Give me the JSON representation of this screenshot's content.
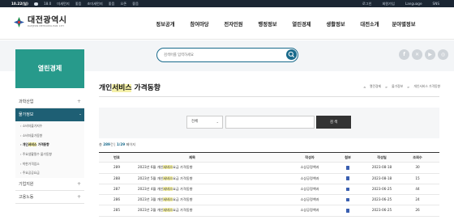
{
  "topbar": {
    "date": "10.22(일)",
    "temp": "18.0",
    "items": [
      "미세먼지",
      "좋음",
      "초미세먼지",
      "좋음",
      "오존",
      "좋음"
    ],
    "right": [
      "로그인",
      "회원가입",
      "Language",
      "SNS"
    ]
  },
  "header": {
    "logo_title": "대전광역시",
    "logo_sub": "DAEJEON METROPOLITAN CITY",
    "gnb": [
      "정보공개",
      "참여마당",
      "전자민원",
      "행정정보",
      "열린경제",
      "생활정보",
      "대전소개",
      "분야별정보"
    ]
  },
  "search": {
    "placeholder": "검색어를 입력하세요"
  },
  "sns": [
    "f",
    "✕",
    "▶",
    "◎"
  ],
  "lnb": {
    "title": "열린경제",
    "items": [
      {
        "label": "과학산업",
        "pm": "+"
      },
      {
        "label": "물가정보",
        "pm": "-"
      }
    ],
    "sub": [
      "› 소비자물가지수",
      "› 소비자물가동향",
      "› 개인",
      "› 주요생활필수 물가동향",
      "› 착한가격업소",
      "› 주요공공요금"
    ],
    "sub_current_pre": "개인",
    "sub_current_hl": "서비스",
    "sub_current_post": " 가격동향",
    "after": [
      {
        "label": "기업지원",
        "pm": "+"
      },
      {
        "label": "고용노동",
        "pm": "+"
      }
    ]
  },
  "page": {
    "title_pre": "개인",
    "title_hl": "서비스",
    "title_post": " 가격동향",
    "crumbs": [
      "⌂",
      "열린경제",
      ">",
      "물가정보",
      ">",
      "개인서비스 가격동향"
    ]
  },
  "board_search": {
    "select_value": "전체",
    "button": "검 색"
  },
  "count": {
    "pre": "총 ",
    "total": "289",
    "mid": "건 | ",
    "page": "1/29",
    "post": " 페이지"
  },
  "table": {
    "headers": [
      "번호",
      "제목",
      "작성자",
      "첨부",
      "작성일",
      "조회수"
    ],
    "rows": [
      {
        "no": "289",
        "title_pre": "2023년 6월 개인",
        "title_hl": "서비스",
        "title_post": "요금 가격동향",
        "writer": "소상공정책과",
        "date": "2023-08-18",
        "views": "30"
      },
      {
        "no": "288",
        "title_pre": "2023년 5월 개인",
        "title_hl": "서비스",
        "title_post": "요금 가격동향",
        "writer": "소상공정책과",
        "date": "2023-08-18",
        "views": "15"
      },
      {
        "no": "287",
        "title_pre": "2023년 4월 개인",
        "title_hl": "서비스",
        "title_post": "요금 가격동향",
        "writer": "소상공정책과",
        "date": "2023-06-25",
        "views": "44"
      },
      {
        "no": "286",
        "title_pre": "2023년 3월 개인",
        "title_hl": "서비스",
        "title_post": "요금 가격동향",
        "writer": "소상공정책과",
        "date": "2023-06-25",
        "views": "24"
      },
      {
        "no": "285",
        "title_pre": "2023년 2월 개인",
        "title_hl": "서비스",
        "title_post": "요금 가격동향",
        "writer": "소상공정책과",
        "date": "2023-06-25",
        "views": "26"
      }
    ]
  }
}
